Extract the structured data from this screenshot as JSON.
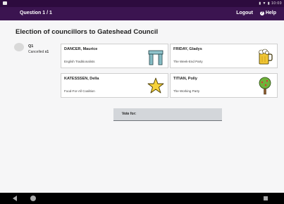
{
  "status_bar": {
    "right_text": "▮ ▼ ▮ 10:00"
  },
  "header": {
    "question": "Question 1 / 1",
    "logout": "Logout",
    "help": "Help"
  },
  "title": "Election of councillors to Gateshead Council",
  "sidebar": {
    "q_label": "Q1",
    "cancelled_prefix": "Cancelled",
    "cancelled_count": "x1"
  },
  "candidates": [
    {
      "name": "DANCER, Maurice",
      "party": "English Traditionalists",
      "icon": "stonehenge-icon"
    },
    {
      "name": "FRIDAY, Gladys",
      "party": "The Week-End Party",
      "icon": "beer-mug-icon"
    },
    {
      "name": "KATESSSEN, Della",
      "party": "Food-For-All Coalition",
      "icon": "star-icon"
    },
    {
      "name": "TITIAN, Polly",
      "party": "The Working Party",
      "icon": "tree-icon"
    }
  ],
  "vote": {
    "label": "Vote for:"
  },
  "colors": {
    "header": "#3b1450",
    "status": "#2d0b3e"
  }
}
